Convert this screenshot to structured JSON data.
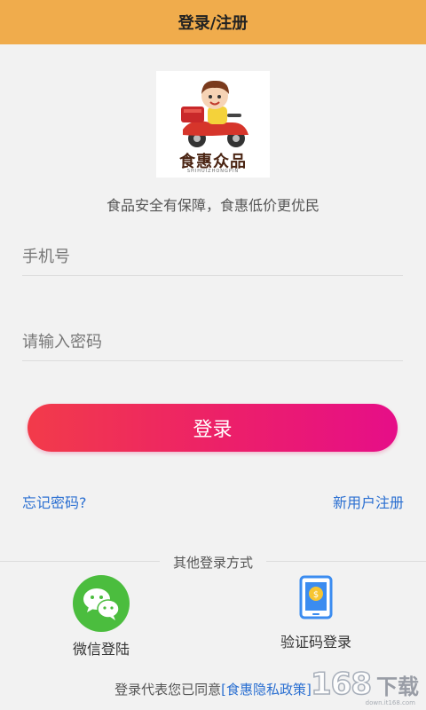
{
  "header": {
    "title": "登录/注册"
  },
  "logo": {
    "brand": "食惠众品",
    "sub": "SHIHUIZHONGPIN"
  },
  "slogan": "食品安全有保障，食惠低价更优民",
  "form": {
    "phone_placeholder": "手机号",
    "password_placeholder": "请输入密码",
    "login_label": "登录"
  },
  "links": {
    "forgot": "忘记密码?",
    "register": "新用户注册"
  },
  "other": {
    "title": "其他登录方式",
    "wechat_label": "微信登陆",
    "sms_label": "验证码登录"
  },
  "footer": {
    "prefix": "登录代表您已同意",
    "policy": "[食惠隐私政策]"
  },
  "watermark": {
    "num": "168",
    "text": "下载",
    "url": "down.it168.com"
  },
  "colors": {
    "header": "#f0ac4c",
    "button_start": "#f23b4a",
    "button_end": "#e60e88",
    "link": "#2a6fd1",
    "wechat": "#4bbd3e",
    "sms_icon": "#3b8cf0"
  }
}
